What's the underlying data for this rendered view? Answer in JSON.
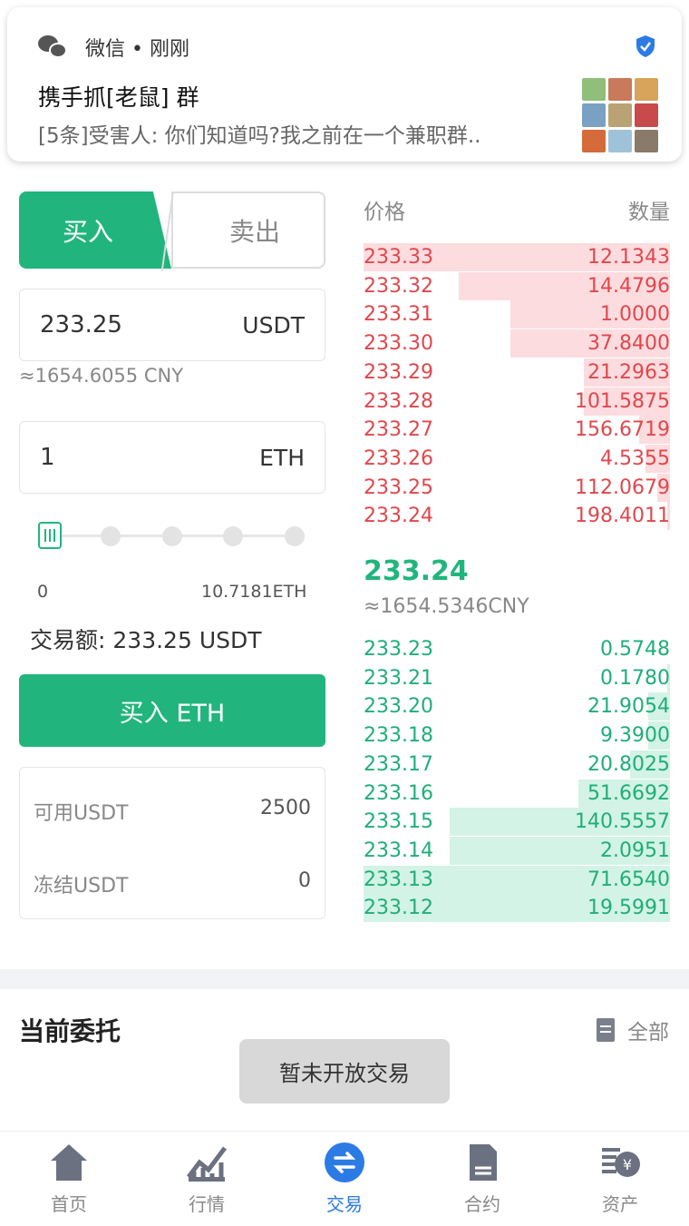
{
  "notification": {
    "app_name": "微信 • 刚刚",
    "title": "携手抓[老鼠] 群",
    "message": "[5条]受害人: 你们知道吗?我之前在一个兼职群..",
    "app_icon": "wechat-icon",
    "badge_icon": "verified-shield-icon"
  },
  "trade_panel": {
    "tab_buy": "买入",
    "tab_sell": "卖出",
    "price_value": "233.25",
    "price_unit": "USDT",
    "price_cny": "≈1654.6055 CNY",
    "amount_value": "1",
    "amount_unit": "ETH",
    "slider_level": 0,
    "slider_min": "0",
    "slider_max": "10.7181ETH",
    "trade_amount_label": "交易额:",
    "trade_amount_value": "233.25 USDT",
    "buy_button": "买入 ETH",
    "available_label": "可用USDT",
    "available_value": "2500",
    "frozen_label": "冻结USDT",
    "frozen_value": "0",
    "accent_color": "#21b57d"
  },
  "order_book": {
    "price_header": "价格",
    "qty_header": "数量",
    "asks": [
      {
        "price": "233.33",
        "qty": "12.1343",
        "depth": 1.0
      },
      {
        "price": "233.32",
        "qty": "14.4796",
        "depth": 0.69
      },
      {
        "price": "233.31",
        "qty": "1.0000",
        "depth": 0.52
      },
      {
        "price": "233.30",
        "qty": "37.8400",
        "depth": 0.52
      },
      {
        "price": "233.29",
        "qty": "21.2963",
        "depth": 0.28
      },
      {
        "price": "233.28",
        "qty": "101.5875",
        "depth": 0.28
      },
      {
        "price": "233.27",
        "qty": "156.6719",
        "depth": 0.1
      },
      {
        "price": "233.26",
        "qty": "4.5355",
        "depth": 0.08
      },
      {
        "price": "233.25",
        "qty": "112.0679",
        "depth": 0.04
      },
      {
        "price": "233.24",
        "qty": "198.4011",
        "depth": 0.01
      }
    ],
    "mid_price": "233.24",
    "mid_cny": "≈1654.5346CNY",
    "bids": [
      {
        "price": "233.23",
        "qty": "0.5748",
        "depth": 0.0
      },
      {
        "price": "233.21",
        "qty": "0.1780",
        "depth": 0.01
      },
      {
        "price": "233.20",
        "qty": "21.9054",
        "depth": 0.07
      },
      {
        "price": "233.18",
        "qty": "9.3900",
        "depth": 0.07
      },
      {
        "price": "233.17",
        "qty": "20.8025",
        "depth": 0.13
      },
      {
        "price": "233.16",
        "qty": "51.6692",
        "depth": 0.3
      },
      {
        "price": "233.15",
        "qty": "140.5557",
        "depth": 0.72
      },
      {
        "price": "233.14",
        "qty": "2.0951",
        "depth": 0.72
      },
      {
        "price": "233.13",
        "qty": "71.6540",
        "depth": 1.0
      },
      {
        "price": "233.12",
        "qty": "19.5991",
        "depth": 1.0
      }
    ],
    "ask_color": "#e0474c",
    "bid_color": "#1fae79"
  },
  "entrust": {
    "title": "当前委托",
    "all_link": "全部"
  },
  "toast": "暂未开放交易",
  "bottom_nav": [
    {
      "label": "首页",
      "icon": "home-icon"
    },
    {
      "label": "行情",
      "icon": "chart-icon"
    },
    {
      "label": "交易",
      "icon": "exchange-icon",
      "active": true
    },
    {
      "label": "合约",
      "icon": "contract-icon"
    },
    {
      "label": "资产",
      "icon": "assets-icon"
    }
  ]
}
